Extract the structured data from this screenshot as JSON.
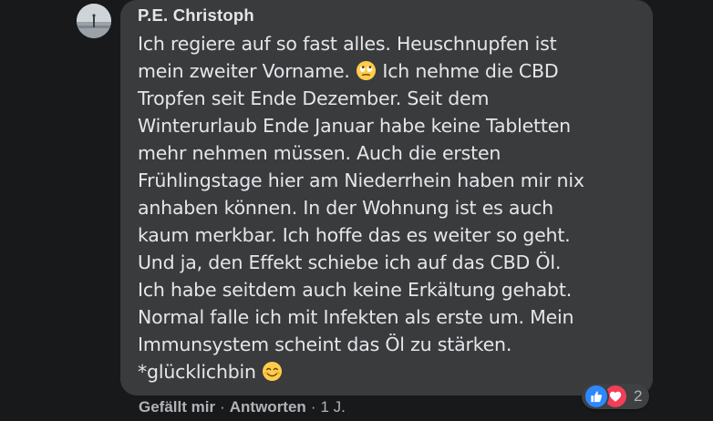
{
  "comment": {
    "author": "P.E. Christoph",
    "text_lines": [
      "Ich regiere auf so fast alles. Heuschnupfen ist",
      "mein zweiter Vorname.",
      " Ich nehme die CBD",
      "Tropfen seit Ende Dezember. Seit dem\nWinterurlaub Ende Januar habe keine Tabletten\nmehr nehmen müssen. Auch die ersten\nFrühlingstage hier am Niederrhein haben mir nix\nanhaben können. In der Wohnung ist es auch\nkaum merkbar. Ich hoffe das es weiter so geht.\nUnd ja, den Effekt schiebe ich auf das CBD Öl.\nIch habe seitdem auch keine Erkältung gehabt.\nNormal falle ich mit Infekten als erste um. Mein\nImmunsystem scheint das Öl zu stärken.",
      "*glücklichbin"
    ],
    "emojis": [
      "eye-roll-emoji",
      "smiling-emoji"
    ]
  },
  "actions": {
    "like": "Gefällt mir",
    "reply": "Antworten",
    "separator": "·",
    "time": "1 J."
  },
  "reactions": {
    "types": [
      "like-icon",
      "love-icon"
    ],
    "count": "2"
  },
  "colors": {
    "background": "#18191a",
    "bubble": "#3a3b3c",
    "text": "#e4e6eb",
    "secondary_text": "#b0b3b8",
    "like_blue": "#2d88ff",
    "love_red": "#f33e58"
  }
}
